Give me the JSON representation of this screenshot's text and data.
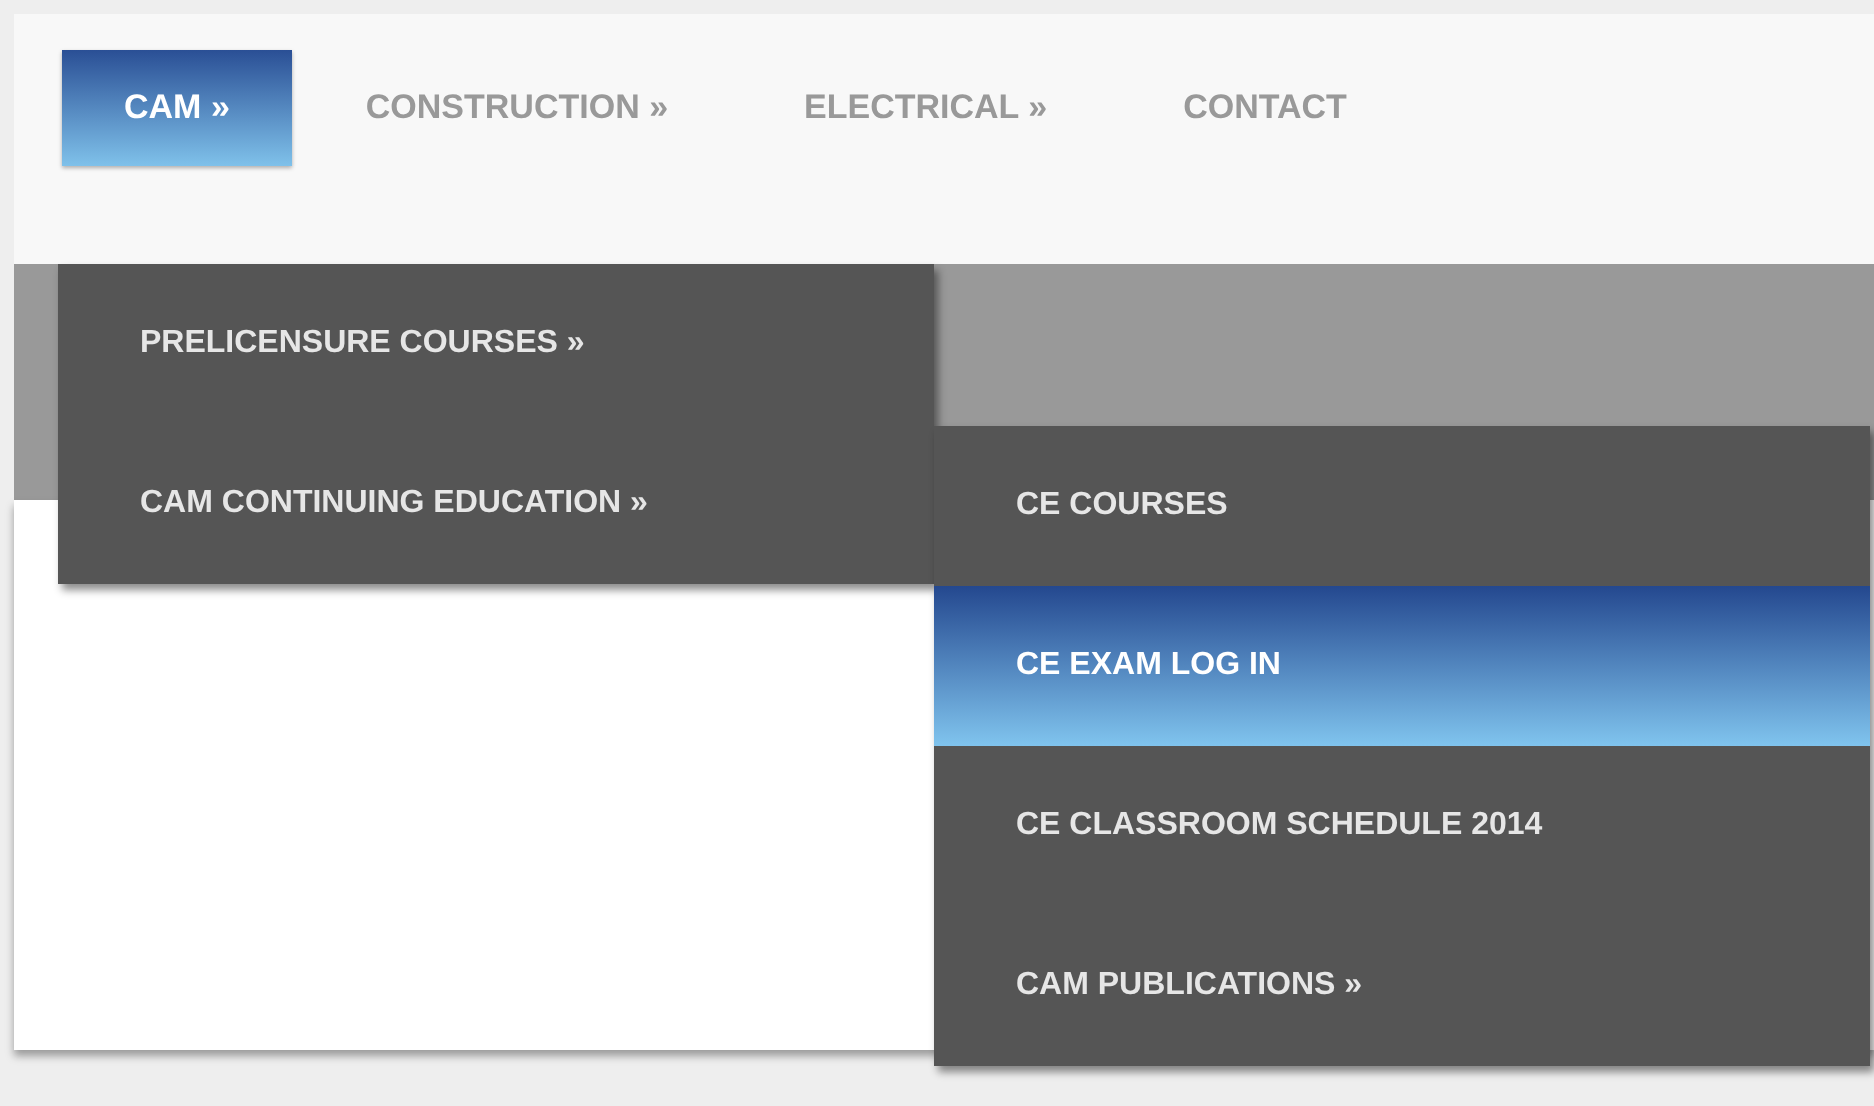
{
  "nav": [
    {
      "label": "CAM »",
      "selected": true
    },
    {
      "label": "CONSTRUCTION »",
      "selected": false
    },
    {
      "label": "ELECTRICAL »",
      "selected": false
    },
    {
      "label": "CONTACT",
      "selected": false
    }
  ],
  "submenu": [
    {
      "label": "PRELICENSURE COURSES »",
      "selected": false
    },
    {
      "label": "CAM CONTINUING EDUCATION »",
      "selected": false
    }
  ],
  "subsubmenu": [
    {
      "label": "CE COURSES",
      "selected": false
    },
    {
      "label": "CE EXAM LOG IN",
      "selected": true
    },
    {
      "label": "CE CLASSROOM SCHEDULE 2014",
      "selected": false
    },
    {
      "label": "CAM PUBLICATIONS »",
      "selected": false
    }
  ]
}
